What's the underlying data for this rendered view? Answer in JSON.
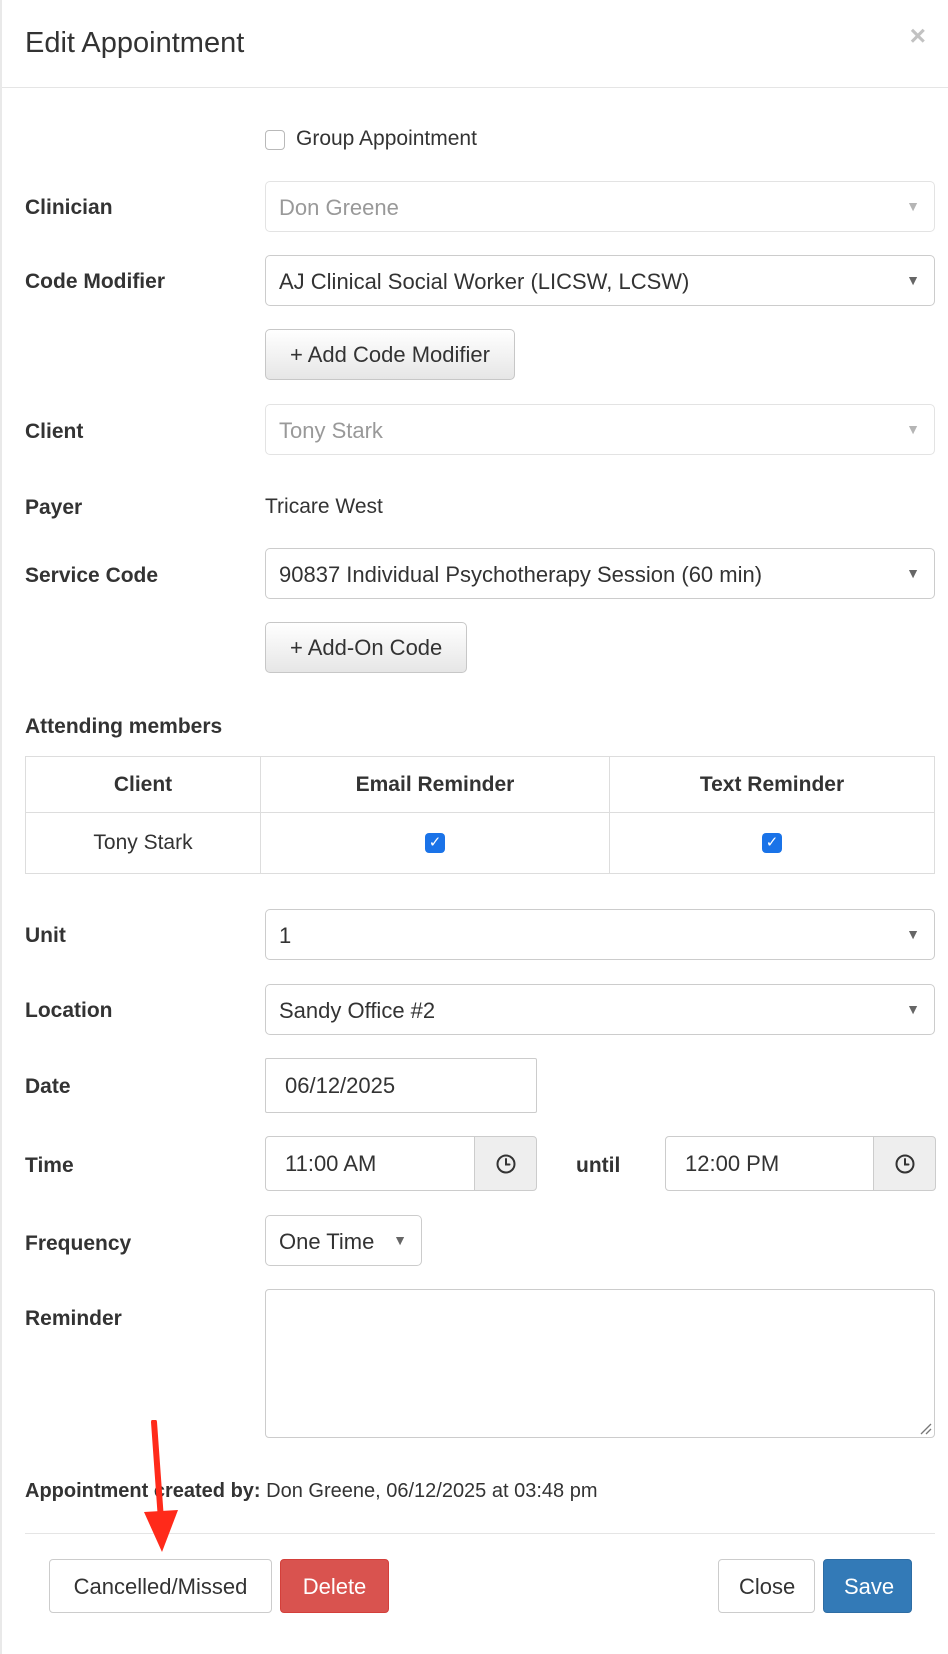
{
  "modal": {
    "title": "Edit Appointment",
    "close_glyph": "×"
  },
  "form": {
    "group_appointment_label": "Group Appointment",
    "clinician": {
      "label": "Clinician",
      "value": "Don Greene"
    },
    "code_modifier": {
      "label": "Code Modifier",
      "value": "AJ Clinical Social Worker (LICSW, LCSW)",
      "add_button": "+ Add Code Modifier"
    },
    "client": {
      "label": "Client",
      "value": "Tony Stark"
    },
    "payer": {
      "label": "Payer",
      "value": "Tricare West"
    },
    "service_code": {
      "label": "Service Code",
      "value": "90837 Individual Psychotherapy Session (60 min)",
      "add_button": "+ Add-On Code"
    },
    "attending": {
      "label": "Attending members",
      "columns": [
        "Client",
        "Email Reminder",
        "Text Reminder"
      ],
      "rows": [
        {
          "client": "Tony Stark",
          "email_reminder": true,
          "text_reminder": true
        }
      ]
    },
    "unit": {
      "label": "Unit",
      "value": "1"
    },
    "location": {
      "label": "Location",
      "value": "Sandy Office #2"
    },
    "date": {
      "label": "Date",
      "value": "06/12/2025"
    },
    "time": {
      "label": "Time",
      "start": "11:00 AM",
      "until_label": "until",
      "end": "12:00 PM"
    },
    "frequency": {
      "label": "Frequency",
      "value": "One Time"
    },
    "reminder": {
      "label": "Reminder",
      "value": ""
    }
  },
  "created_by": {
    "label": "Appointment created by:",
    "value": "Don Greene, 06/12/2025 at 03:48 pm"
  },
  "footer": {
    "cancelled_missed": "Cancelled/Missed",
    "delete": "Delete",
    "close": "Close",
    "save": "Save"
  },
  "colors": {
    "primary": "#337ab7",
    "danger": "#d9534f",
    "checkbox": "#1a73e8",
    "annotation_arrow": "#ff2a1a"
  },
  "icons": {
    "dropdown": "caret-down-icon",
    "time": "clock-icon",
    "annotation": "red-arrow-icon"
  }
}
